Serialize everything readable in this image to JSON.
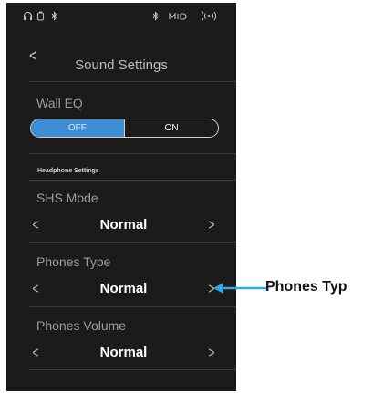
{
  "status_icons": [
    "headphones-icon",
    "usb-icon",
    "bluetooth-icon",
    "bluetooth-audio-icon",
    "midi-icon",
    "wireless-icon"
  ],
  "header": {
    "back_label": "<",
    "title": "Sound Settings"
  },
  "wall_eq": {
    "label": "Wall EQ",
    "options": [
      "OFF",
      "ON"
    ],
    "selected": "OFF",
    "accent_color": "#3f8ed4"
  },
  "headphone_section": {
    "label": "Headphone Settings"
  },
  "settings": [
    {
      "label": "SHS Mode",
      "value": "Normal"
    },
    {
      "label": "Phones Type",
      "value": "Normal"
    },
    {
      "label": "Phones Volume",
      "value": "Normal"
    }
  ],
  "callout": {
    "text": "Phones Typ",
    "color": "#38a8e0"
  }
}
